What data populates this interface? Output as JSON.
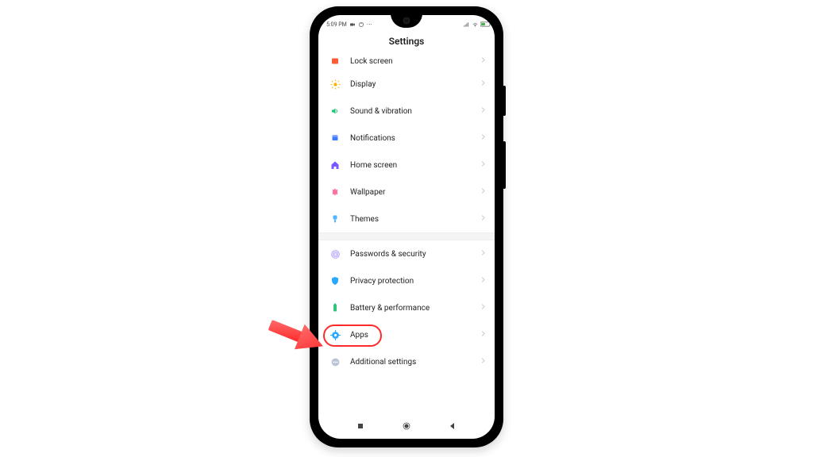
{
  "status": {
    "time": "5:09 PM",
    "indicators_left": [
      "camera",
      "sync",
      "more"
    ],
    "indicators_right": [
      "signal",
      "wifi",
      "battery"
    ]
  },
  "header": {
    "title": "Settings"
  },
  "groups": [
    {
      "items": [
        {
          "key": "lock-screen",
          "label": "Lock screen",
          "icon": "lock",
          "color": "#ff5b3a"
        },
        {
          "key": "display",
          "label": "Display",
          "icon": "sun",
          "color": "#ffb300"
        },
        {
          "key": "sound",
          "label": "Sound & vibration",
          "icon": "volume",
          "color": "#1fc47a"
        },
        {
          "key": "notifications",
          "label": "Notifications",
          "icon": "bell",
          "color": "#3e7bff"
        },
        {
          "key": "home-screen",
          "label": "Home screen",
          "icon": "home",
          "color": "#7a59ff"
        },
        {
          "key": "wallpaper",
          "label": "Wallpaper",
          "icon": "wallpaper",
          "color": "#ff6fa4"
        },
        {
          "key": "themes",
          "label": "Themes",
          "icon": "brush",
          "color": "#4fb7ff"
        }
      ]
    },
    {
      "items": [
        {
          "key": "passwords",
          "label": "Passwords & security",
          "icon": "fingerprint",
          "color": "#b29cff"
        },
        {
          "key": "privacy",
          "label": "Privacy protection",
          "icon": "shield",
          "color": "#2aa9ff"
        },
        {
          "key": "battery",
          "label": "Battery & performance",
          "icon": "battery",
          "color": "#33c37a"
        },
        {
          "key": "apps",
          "label": "Apps",
          "icon": "gear",
          "color": "#2aa9ff",
          "highlighted": true
        },
        {
          "key": "additional",
          "label": "Additional settings",
          "icon": "dots",
          "color": "#b9c4d6"
        }
      ]
    }
  ],
  "nav": {
    "recent": "■",
    "home": "●",
    "back": "◀"
  },
  "annotation": {
    "arrow_label": "callout-arrow"
  }
}
